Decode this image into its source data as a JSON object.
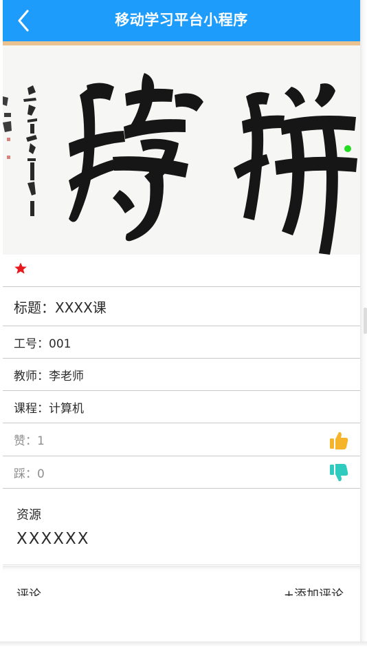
{
  "header": {
    "title": "移动学习平台小程序"
  },
  "detail": {
    "title_row": "标题：XXXX课",
    "id_row": "工号：001",
    "teacher_row": "教师：李老师",
    "course_row": "课程：计算机",
    "likes_row": "赞：1",
    "dislikes_row": "踩：0"
  },
  "resource": {
    "label": "资源",
    "value": "XXXXXX"
  },
  "comments": {
    "label": "评论",
    "add_label": "+添加评论"
  },
  "colors": {
    "header": "#1e9cfc",
    "accent": "#eac28f",
    "star": "#e5191e",
    "like": "#f6b42b",
    "dislike": "#2ecbbe"
  },
  "icons": {
    "back": "chevron-left-icon",
    "favorite": "star-icon",
    "like": "thumbs-up-icon",
    "dislike": "thumbs-down-icon"
  }
}
